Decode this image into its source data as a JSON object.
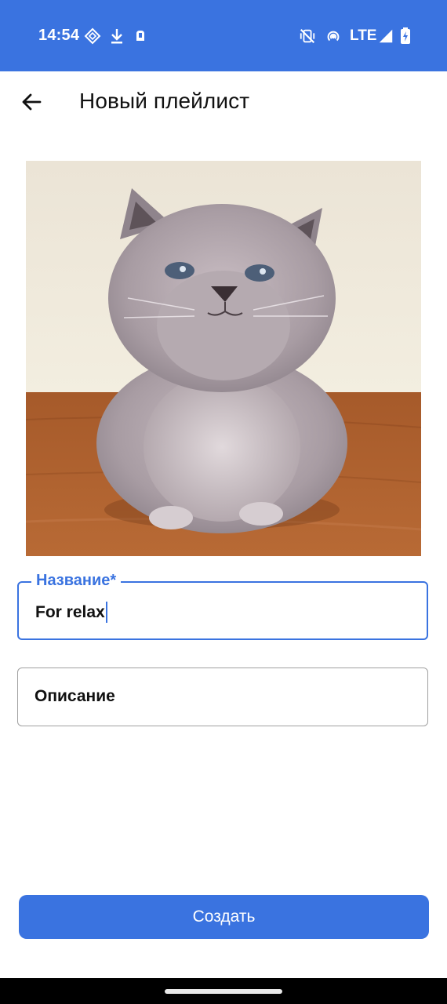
{
  "status_bar": {
    "time": "14:54",
    "network": "LTE",
    "icons": [
      "diamond-app-icon",
      "download-icon",
      "alert-app-icon",
      "mute-vibrate-icon",
      "hotspot-icon",
      "signal-icon",
      "battery-charging-icon"
    ]
  },
  "header": {
    "title": "Новый плейлист",
    "back_icon": "arrow-left-icon"
  },
  "cover": {
    "subject": "playlist cover photo"
  },
  "form": {
    "name_label": "Название*",
    "name_value": "For relax",
    "description_placeholder": "Описание"
  },
  "actions": {
    "create_label": "Создать"
  },
  "colors": {
    "accent": "#3a73e0",
    "text": "#111111",
    "field_border": "#a0a0a0"
  }
}
